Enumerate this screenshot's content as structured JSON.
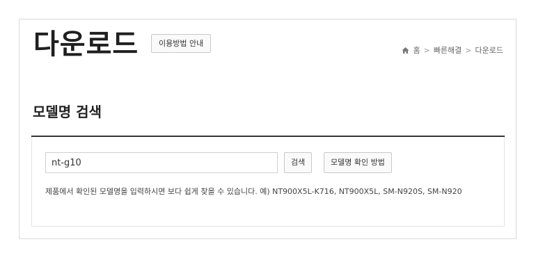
{
  "header": {
    "title": "다운로드",
    "guide_label": "이용방법 안내",
    "breadcrumb": [
      "홈",
      "빠른해결",
      "다운로드"
    ],
    "breadcrumb_sep": ">"
  },
  "section": {
    "title": "모델명 검색"
  },
  "search": {
    "value": "nt-g10",
    "search_label": "검색",
    "howto_label": "모델명 확인 방법",
    "hint": "제품에서 확인된 모델명을 입력하시면 보다 쉽게 찾을 수 있습니다. 예) NT900X5L-K716, NT900X5L, SM-N920S, SM-N920"
  },
  "icons": {
    "home": "home-icon"
  }
}
